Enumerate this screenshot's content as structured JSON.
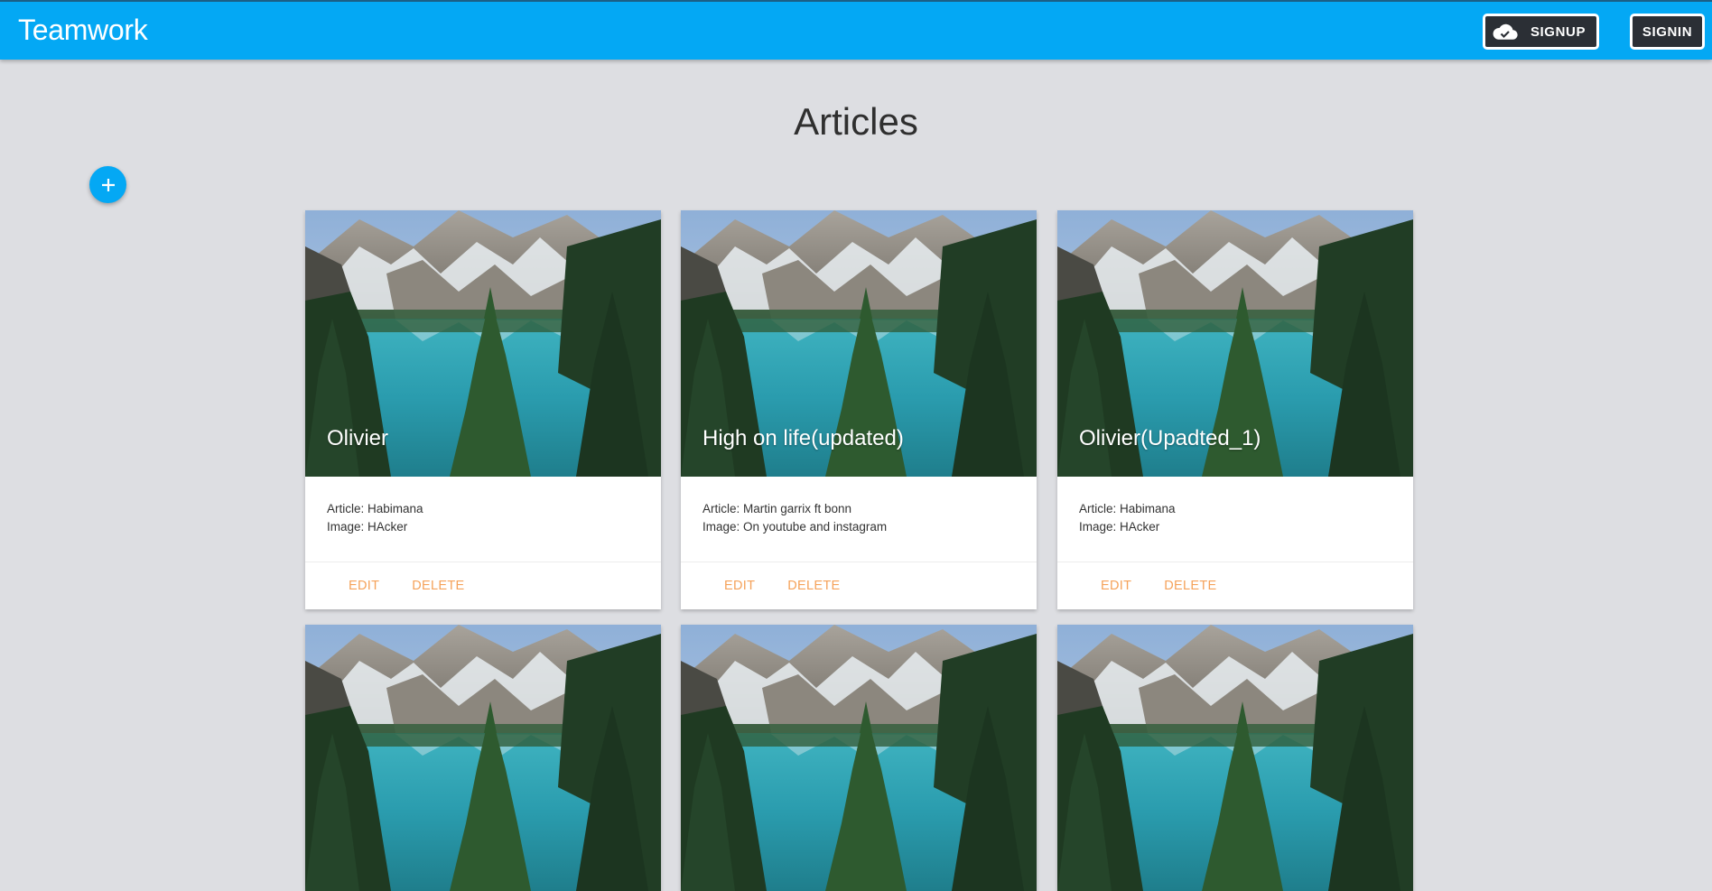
{
  "app": {
    "brand": "Teamwork"
  },
  "header": {
    "signup_label": "SIGNUP",
    "signin_label": "SIGNIN",
    "signup_icon": "cloud-done-icon"
  },
  "page": {
    "title": "Articles",
    "add_icon": "plus-icon"
  },
  "labels": {
    "article_prefix": "Article: ",
    "image_prefix": "Image: "
  },
  "articles": [
    {
      "title": "Olivier",
      "article": "Article: Habimana",
      "image": "Image: HAcker",
      "edit": "EDIT",
      "delete": "DELETE"
    },
    {
      "title": "High on life(updated)",
      "article": "Article: Martin garrix ft bonn",
      "image": "Image: On youtube and instagram",
      "edit": "EDIT",
      "delete": "DELETE"
    },
    {
      "title": "Olivier(Upadted_1)",
      "article": "Article: Habimana",
      "image": "Image: HAcker",
      "edit": "EDIT",
      "delete": "DELETE"
    },
    {
      "title": "",
      "article": "",
      "image": "",
      "edit": "",
      "delete": ""
    },
    {
      "title": "",
      "article": "",
      "image": "",
      "edit": "",
      "delete": ""
    },
    {
      "title": "",
      "article": "",
      "image": "",
      "edit": "",
      "delete": ""
    }
  ],
  "colors": {
    "primary": "#04a8f4",
    "button_dark": "#2b2f35",
    "background": "#dddee2",
    "action": "#f5a25a"
  }
}
